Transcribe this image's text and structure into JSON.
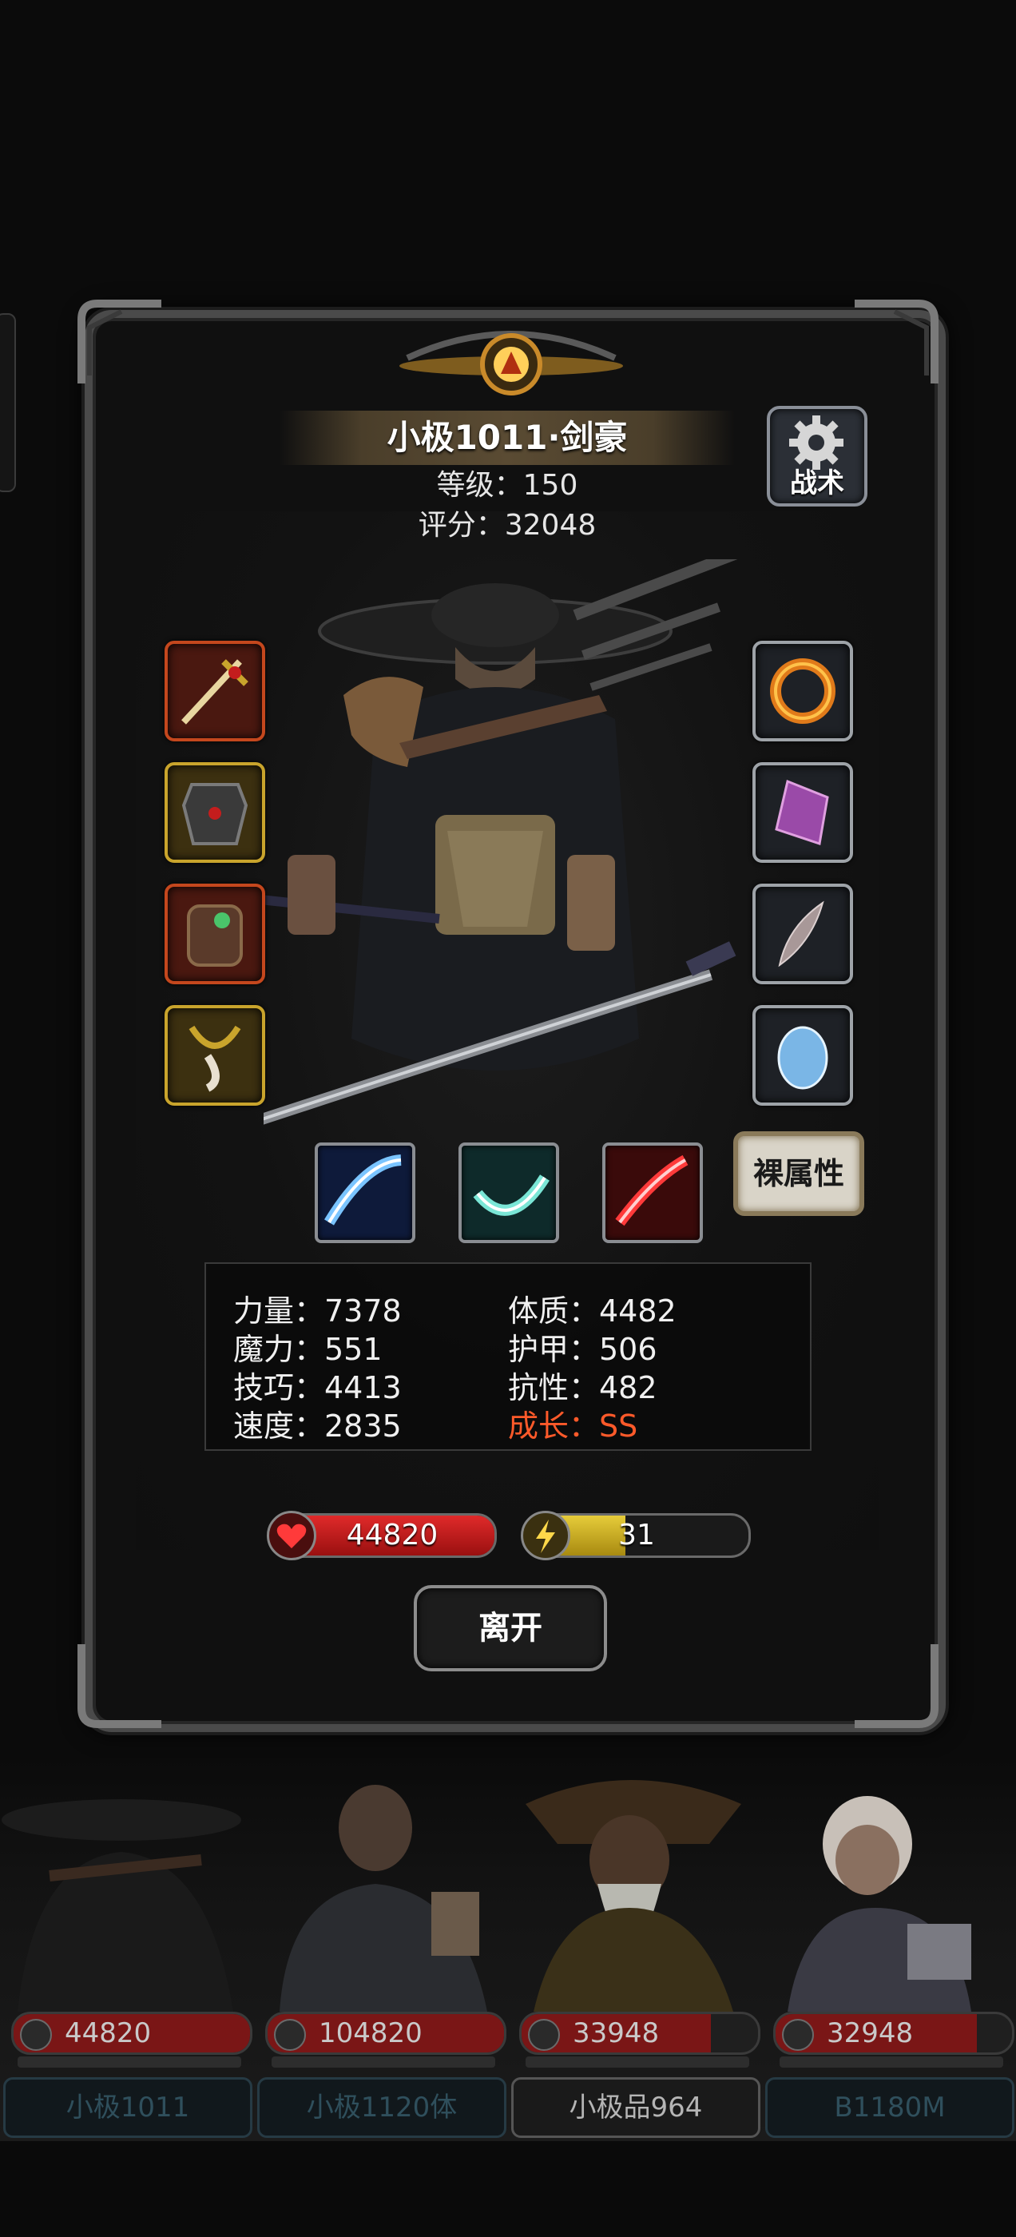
{
  "character": {
    "title": "小极1011·剑豪",
    "level_line": "等级：150",
    "score_line": "评分：32048"
  },
  "buttons": {
    "tactics_label": "战术",
    "bare_attributes_label": "裸属性",
    "leave_label": "离开"
  },
  "stats": {
    "left": [
      "力量：7378",
      "魔力：551",
      "技巧：4413",
      "速度：2835"
    ],
    "right": [
      "体质：4482",
      "护甲：506",
      "抗性：482",
      "成长：SS"
    ],
    "highlight_color": "#ff5a2a"
  },
  "resources": {
    "hp_value": "44820",
    "hp_fill": 1.0,
    "energy_value": "31",
    "energy_fill": 0.45
  },
  "equipment": {
    "left": [
      "sword-item",
      "armor-item",
      "backpack-item",
      "talisman-item"
    ],
    "right": [
      "fire-ring-item",
      "crystal-item",
      "feather-item",
      "ice-gem-item"
    ]
  },
  "skills": [
    "blue-slash-skill",
    "teal-slash-skill",
    "red-slash-skill"
  ],
  "team": [
    {
      "hp": "44820",
      "hp_fill": 1.0,
      "name": "小极1011",
      "selected": false
    },
    {
      "hp": "104820",
      "hp_fill": 1.0,
      "name": "小极1120体",
      "selected": false
    },
    {
      "hp": "33948",
      "hp_fill": 0.8,
      "name": "小极品964",
      "selected": true
    },
    {
      "hp": "32948",
      "hp_fill": 0.85,
      "name": "B1180M",
      "selected": false
    }
  ],
  "colors": {
    "hp_red": "#c81b1b",
    "energy_gold": "#c9b02a",
    "panel_border": "#4a4a4a"
  }
}
